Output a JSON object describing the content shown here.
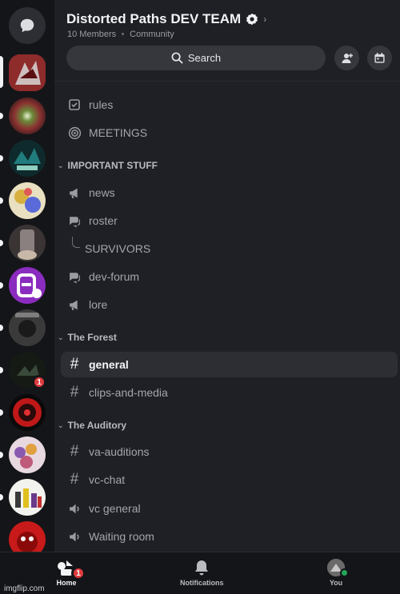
{
  "server": {
    "name": "Distorted Paths DEV TEAM",
    "members": "10 Members",
    "type": "Community"
  },
  "search": {
    "label": "Search"
  },
  "rail": {
    "servers": [
      {
        "name": "server-1",
        "color": "#b03a3a",
        "active": true,
        "unread": false
      },
      {
        "name": "server-2",
        "color": "#6a8a3a",
        "active": false,
        "unread": true
      },
      {
        "name": "server-3",
        "color": "#1a4a4a",
        "active": false,
        "unread": true
      },
      {
        "name": "server-4",
        "color": "#d8c060",
        "active": false,
        "unread": true
      },
      {
        "name": "server-5",
        "color": "#5a5050",
        "active": false,
        "unread": true
      },
      {
        "name": "server-6",
        "color": "#8a2cbf",
        "active": false,
        "unread": true
      },
      {
        "name": "server-7",
        "color": "#404040",
        "active": false,
        "unread": true
      },
      {
        "name": "server-8",
        "color": "#202820",
        "active": false,
        "unread": true,
        "badge": "1"
      },
      {
        "name": "server-9",
        "color": "#c01818",
        "active": false,
        "unread": true
      },
      {
        "name": "server-10",
        "color": "#b870a0",
        "active": false,
        "unread": true
      },
      {
        "name": "server-11",
        "color": "#e8e8e0",
        "active": false,
        "unread": true
      },
      {
        "name": "server-12",
        "color": "#c81a1a",
        "active": false,
        "unread": false
      }
    ]
  },
  "channels": {
    "top": [
      {
        "label": "rules",
        "icon": "rules-icon"
      },
      {
        "label": "MEETINGS",
        "icon": "stage-icon"
      }
    ],
    "cat1": {
      "label": "IMPORTANT STUFF"
    },
    "important": [
      {
        "label": "news",
        "icon": "announcement-icon"
      },
      {
        "label": "roster",
        "icon": "forum-icon"
      },
      {
        "label": "SURVIVORS",
        "icon": "thread"
      },
      {
        "label": "dev-forum",
        "icon": "forum-icon"
      },
      {
        "label": "lore",
        "icon": "announcement-icon"
      }
    ],
    "cat2": {
      "label": "The Forest"
    },
    "forest": [
      {
        "label": "general",
        "icon": "hash-icon"
      },
      {
        "label": "clips-and-media",
        "icon": "hash-icon"
      }
    ],
    "cat3": {
      "label": "The Auditory"
    },
    "auditory": [
      {
        "label": "va-auditions",
        "icon": "hash-icon"
      },
      {
        "label": "vc-chat",
        "icon": "hash-icon"
      },
      {
        "label": "vc general",
        "icon": "voice-icon"
      },
      {
        "label": "Waiting room",
        "icon": "voice-icon"
      }
    ]
  },
  "nav": {
    "home": "Home",
    "home_badge": "1",
    "notifications": "Notifications",
    "you": "You"
  },
  "watermark": "imgflip.com"
}
